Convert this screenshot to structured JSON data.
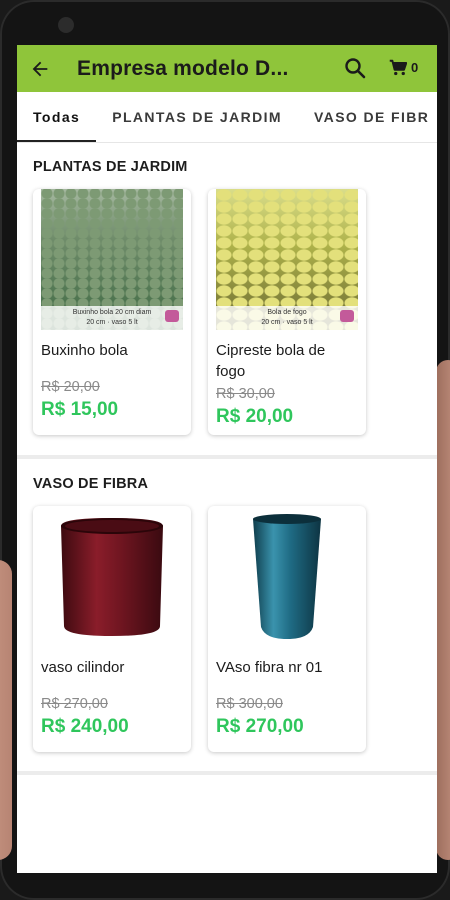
{
  "app": {
    "title": "Empresa modelo D...",
    "cart_count": "0"
  },
  "tabs": [
    {
      "label": "Todas"
    },
    {
      "label": "PLANTAS DE JARDIM"
    },
    {
      "label": "VASO DE FIBR"
    }
  ],
  "sections": [
    {
      "title": "PLANTAS DE JARDIM",
      "products": [
        {
          "name": "Buxinho bola",
          "old_price": "R$ 20,00",
          "price": "R$ 15,00",
          "image_caption_1": "Buxinho bola 20 cm diam",
          "image_caption_2": "20 cm · vaso 5 lt"
        },
        {
          "name": "Cipreste bola de fogo",
          "old_price": "R$ 30,00",
          "price": "R$ 20,00",
          "image_caption_1": "Bola de fogo",
          "image_caption_2": "20 cm · vaso 5 lt"
        }
      ]
    },
    {
      "title": "VASO DE FIBRA",
      "products": [
        {
          "name": "vaso cilindor",
          "old_price": "R$ 270,00",
          "price": "R$ 240,00"
        },
        {
          "name": "VAso fibra nr 01",
          "old_price": "R$ 300,00",
          "price": "R$ 270,00"
        }
      ]
    }
  ],
  "colors": {
    "appbar": "#8fc53a",
    "price": "#2fc65c",
    "vase_1": "#6e1520",
    "vase_2": "#1f6b84"
  },
  "icons": {
    "back": "arrow-back-icon",
    "search": "search-icon",
    "cart": "cart-icon"
  }
}
